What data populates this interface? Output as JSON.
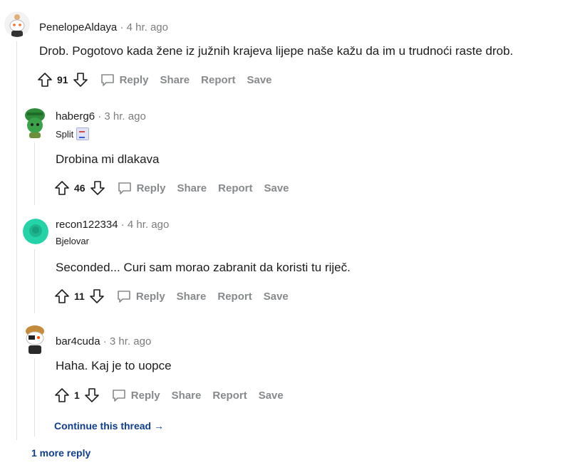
{
  "comments": [
    {
      "username": "PenelopeAldaya",
      "separator": "·",
      "time": "4 hr. ago",
      "flair": "",
      "body": "Drob. Pogotovo kada žene iz južnih krajeva lijepe naše kažu da im u trudnoći raste drob.",
      "score": "91"
    },
    {
      "username": "haberg6",
      "separator": "·",
      "time": "3 hr. ago",
      "flair": "Split",
      "body": "Drobina mi dlakava",
      "score": "46"
    },
    {
      "username": "recon122334",
      "separator": "·",
      "time": "4 hr. ago",
      "flair": "Bjelovar",
      "body": "Seconded... Curi sam morao zabranit da koristi tu riječ.",
      "score": "11"
    },
    {
      "username": "bar4cuda",
      "separator": "·",
      "time": "3 hr. ago",
      "flair": "",
      "body": "Haha. Kaj je to uopce",
      "score": "1"
    }
  ],
  "actions": {
    "reply": "Reply",
    "share": "Share",
    "report": "Report",
    "save": "Save"
  },
  "continue_thread": "Continue this thread →",
  "more_replies": "1 more reply",
  "icons": {
    "upvote": "arrow-up-icon",
    "downvote": "arrow-down-icon",
    "reply": "speech-bubble-icon"
  },
  "colors": {
    "link": "#0f3d91",
    "action_gray": "#878a8c",
    "meta_gray": "#7c7c7c"
  }
}
